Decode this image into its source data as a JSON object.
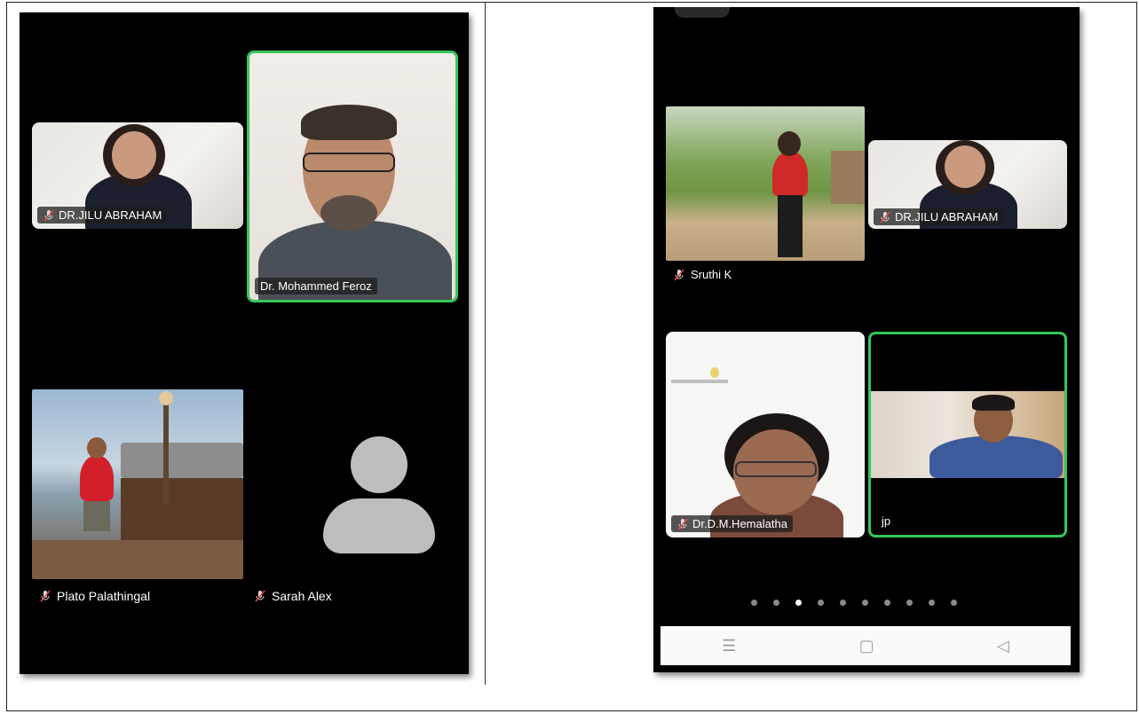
{
  "left_phone": {
    "tiles": [
      {
        "name": "DR.JILU ABRAHAM",
        "muted": true
      },
      {
        "name": "Dr. Mohammed Feroz",
        "muted": false,
        "active_speaker": true
      },
      {
        "name": "Plato Palathingal",
        "muted": true
      },
      {
        "name": "Sarah Alex",
        "muted": true
      }
    ]
  },
  "right_phone": {
    "tiles": [
      {
        "name": "Sruthi K",
        "muted": true
      },
      {
        "name": "DR.JILU ABRAHAM",
        "muted": true
      },
      {
        "name": "Dr.D.M.Hemalatha",
        "muted": true
      },
      {
        "name": "jp",
        "muted": false,
        "active_speaker": true
      }
    ],
    "pagination": {
      "total": 10,
      "current": 3
    },
    "navbar": {
      "menu": "☰",
      "home": "▢",
      "back": "◁"
    }
  },
  "colors": {
    "active_border": "#35c759",
    "background": "#000000"
  },
  "icons": [
    "muted-mic-icon",
    "avatar-placeholder-icon",
    "menu-icon",
    "home-icon",
    "back-icon"
  ]
}
